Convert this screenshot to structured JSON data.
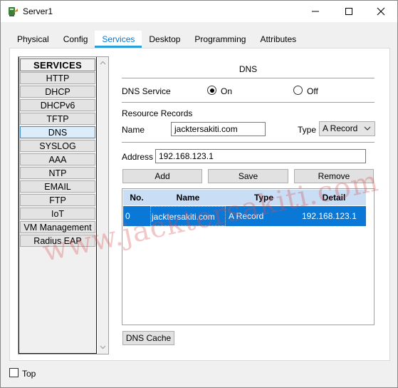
{
  "window": {
    "title": "Server1"
  },
  "tabs": [
    {
      "label": "Physical"
    },
    {
      "label": "Config"
    },
    {
      "label": "Services",
      "active": true
    },
    {
      "label": "Desktop"
    },
    {
      "label": "Programming"
    },
    {
      "label": "Attributes"
    }
  ],
  "services": {
    "header": "SERVICES",
    "items": [
      "HTTP",
      "DHCP",
      "DHCPv6",
      "TFTP",
      "DNS",
      "SYSLOG",
      "AAA",
      "NTP",
      "EMAIL",
      "FTP",
      "IoT",
      "VM Management",
      "Radius EAP"
    ],
    "selected": "DNS"
  },
  "dns": {
    "title": "DNS",
    "service_label": "DNS Service",
    "on_label": "On",
    "off_label": "Off",
    "service_state": "On",
    "resource_records_label": "Resource Records",
    "name_label": "Name",
    "name_value": "jacktersakiti.com",
    "type_label": "Type",
    "type_value": "A Record",
    "address_label": "Address",
    "address_value": "192.168.123.1",
    "add_label": "Add",
    "save_label": "Save",
    "remove_label": "Remove",
    "table": {
      "columns": [
        "No.",
        "Name",
        "Type",
        "Detail"
      ],
      "rows": [
        {
          "no": "0",
          "name": "jacktersakiti.com",
          "type": "A Record",
          "detail": "192.168.123.1"
        }
      ]
    },
    "cache_label": "DNS Cache"
  },
  "watermark": "www.jacktersakiti.com",
  "footer": {
    "top_label": "Top",
    "top_checked": false
  },
  "colors": {
    "accent": "#0078d7",
    "selected_row": "#0a78d7",
    "table_header": "#c9def5",
    "watermark": "#d65050"
  }
}
